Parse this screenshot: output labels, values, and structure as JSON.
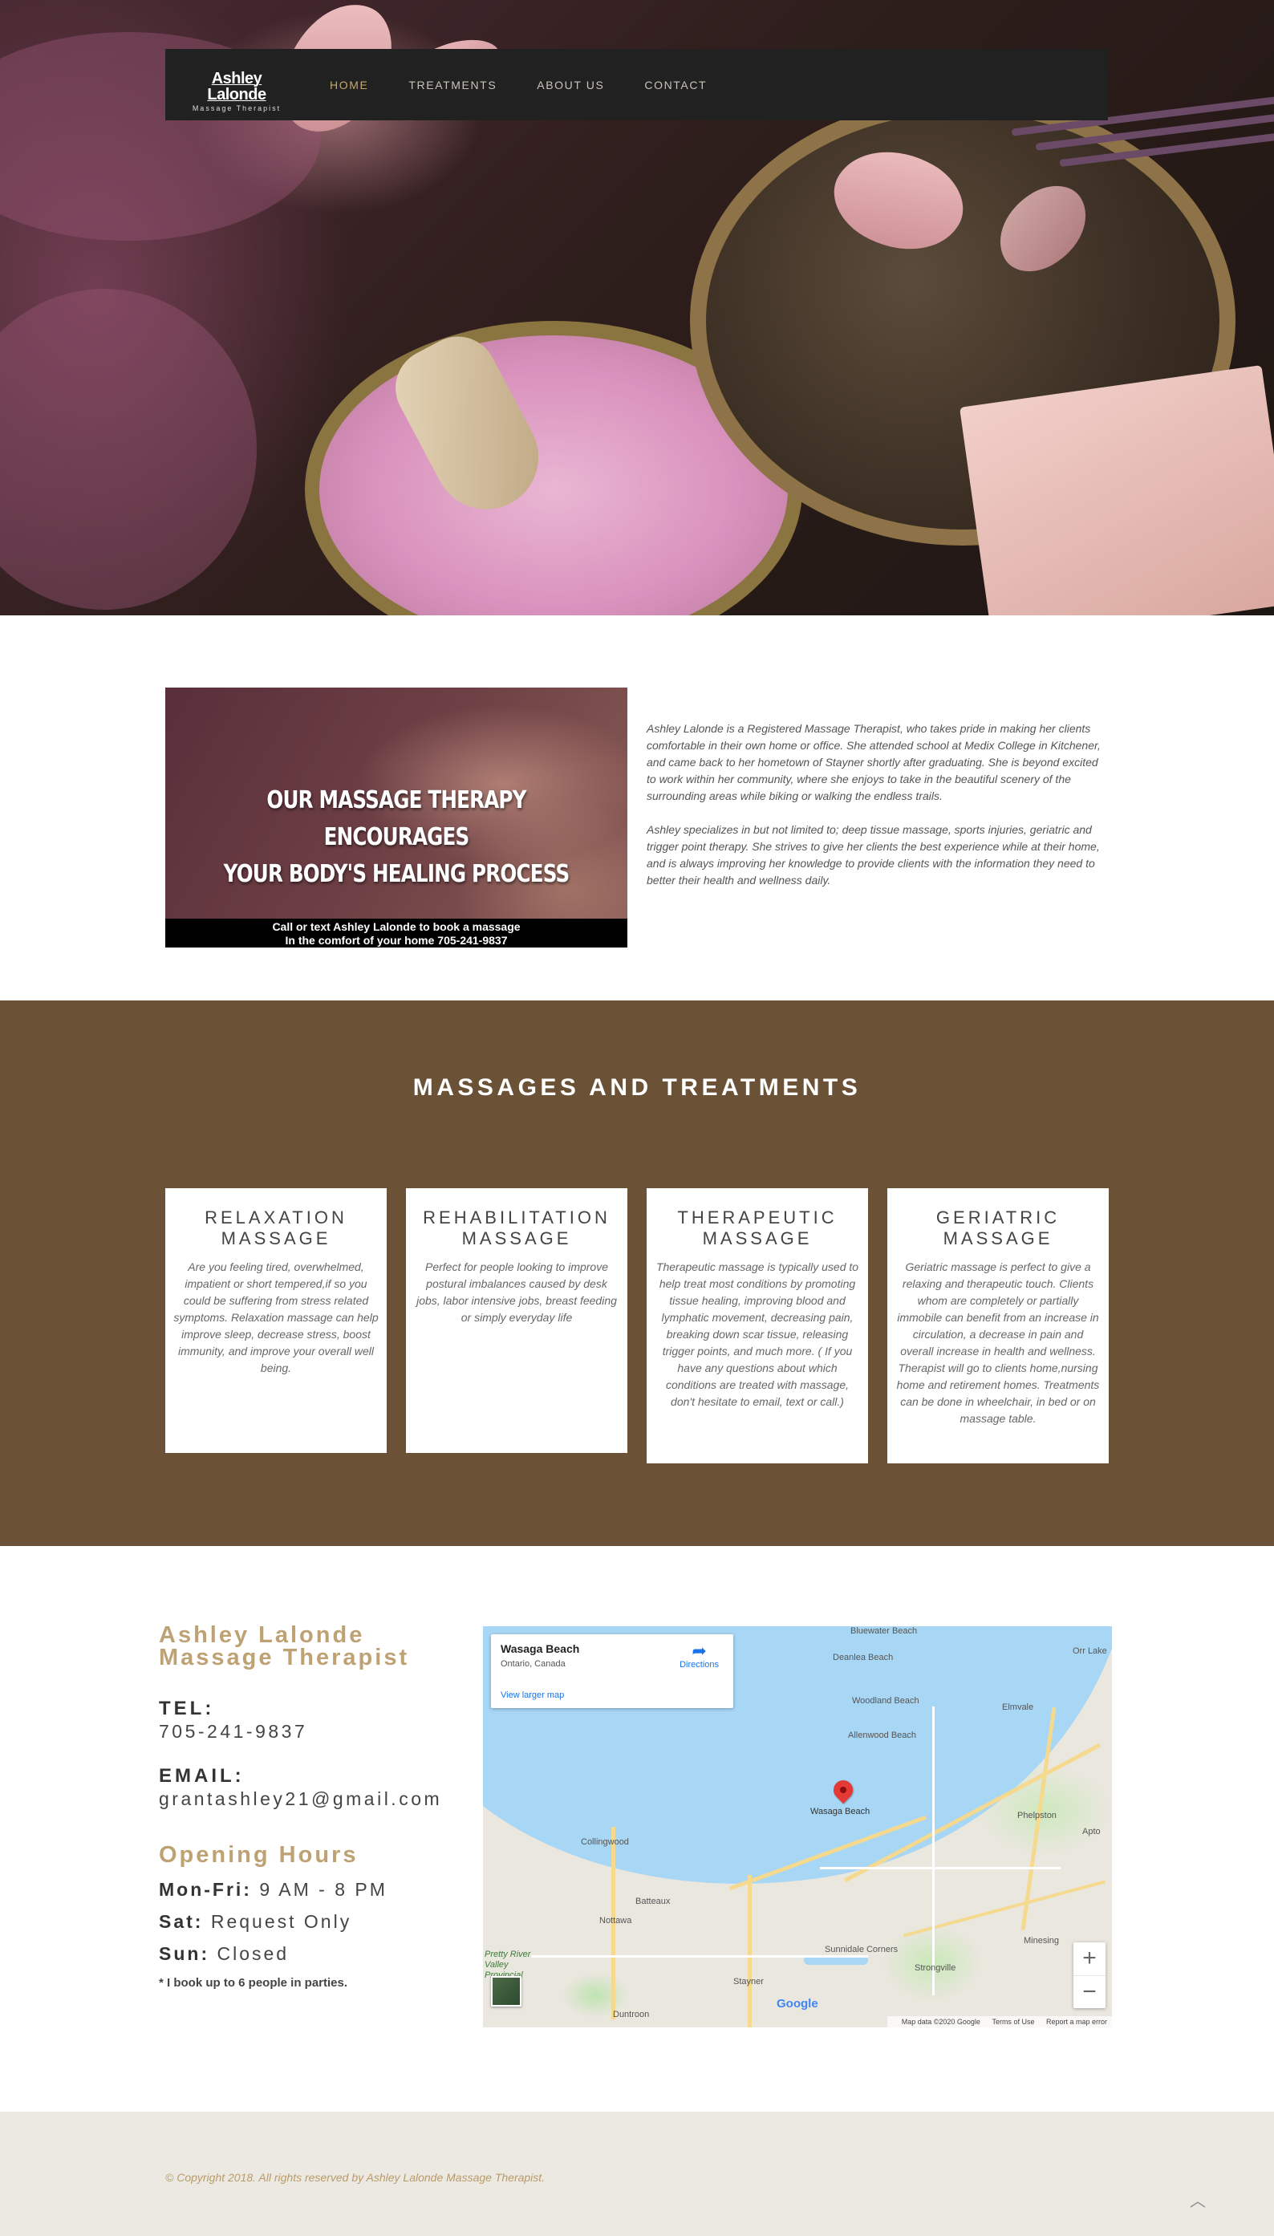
{
  "header": {
    "logo_name": "Ashley Lalonde",
    "logo_sub": "Massage Therapist",
    "nav": [
      {
        "label": "HOME",
        "active": true
      },
      {
        "label": "TREATMENTS",
        "active": false
      },
      {
        "label": "ABOUT US",
        "active": false
      },
      {
        "label": "CONTACT",
        "active": false
      }
    ]
  },
  "about": {
    "promo_headline_1": "OUR MASSAGE THERAPY ENCOURAGES",
    "promo_headline_2": "YOUR BODY'S HEALING PROCESS",
    "promo_bar_1": "Call or text Ashley Lalonde to book a massage",
    "promo_bar_2": "In the comfort of your home 705-241-9837",
    "paragraph_1": "Ashley Lalonde is a Registered Massage Therapist, who takes pride in making her clients comfortable in their own home or office. She attended school at Medix College in Kitchener, and came back to her hometown of Stayner shortly after graduating. She is beyond excited to work within her community, where she enjoys to take in the beautiful scenery of the surrounding areas while biking or walking the endless trails.",
    "paragraph_2": "Ashley specializes in but not limited to; deep tissue massage, sports injuries, geriatric and trigger point therapy. She strives to give her clients the best experience while at their home, and is always improving her knowledge to provide clients with the information they need to better their health and wellness daily."
  },
  "treatments": {
    "title": "MASSAGES AND TREATMENTS",
    "cards": [
      {
        "title": "RELAXATION MASSAGE",
        "desc": "Are you feeling tired, overwhelmed, impatient or short tempered,if so you could be suffering from stress related symptoms. Relaxation massage can help improve sleep, decrease stress, boost immunity, and improve your overall well being."
      },
      {
        "title": "REHABILITATION MASSAGE",
        "desc": "Perfect for people looking to improve postural imbalances caused by desk jobs, labor intensive jobs, breast feeding or simply everyday life"
      },
      {
        "title": "THERAPEUTIC MASSAGE",
        "desc": "Therapeutic massage is typically used to help treat most conditions by promoting tissue healing, improving blood and lymphatic movement, decreasing pain, breaking down scar tissue, releasing trigger points, and much more. ( If you have any questions about which conditions are treated with massage, don't hesitate to email, text or call.)"
      },
      {
        "title": "GERIATRIC MASSAGE",
        "desc": "Geriatric massage is perfect to give a relaxing and therapeutic touch. Clients whom are completely or partially immobile can benefit from an increase in circulation, a decrease in pain and overall increase in health and wellness. Therapist will go to clients home,nursing home and retirement homes. Treatments can be done in wheelchair, in bed or on massage table."
      }
    ]
  },
  "contact": {
    "brand_1": "Ashley Lalonde",
    "brand_2": "Massage Therapist",
    "tel_label": "TEL:",
    "tel": "705-241-9837",
    "email_label": "EMAIL:",
    "email": "grantashley21@gmail.com",
    "hours_title": "Opening Hours",
    "hours": [
      {
        "day": "Mon-Fri:",
        "time": "9 AM - 8 PM"
      },
      {
        "day": "Sat:",
        "time": "Request Only"
      },
      {
        "day": "Sun:",
        "time": "Closed"
      }
    ],
    "note": "* I book up to 6 people in parties."
  },
  "map": {
    "place_title": "Wasaga Beach",
    "place_sub": "Ontario, Canada",
    "directions": "Directions",
    "larger_map": "View larger map",
    "pin_label": "Wasaga Beach",
    "labels": [
      "Bluewater Beach",
      "Deanlea Beach",
      "Woodland Beach",
      "Allenwood Beach",
      "Elmvale",
      "Orr Lake",
      "Phelpston",
      "Collingwood",
      "Batteaux",
      "Nottawa",
      "Sunnidale Corners",
      "Stayner",
      "Minesing",
      "Strongville",
      "Pretty River Valley Provincial",
      "Duntroon",
      "Apto"
    ],
    "zoom_in": "+",
    "zoom_out": "−",
    "google": "Google",
    "footer_data": "Map data ©2020 Google",
    "footer_terms": "Terms of Use",
    "footer_report": "Report a map error"
  },
  "footer": {
    "copyright": "© Copyright 2018. All rights reserved by Ashley Lalonde Massage Therapist.",
    "to_top_icon": "chevron-up-icon"
  }
}
